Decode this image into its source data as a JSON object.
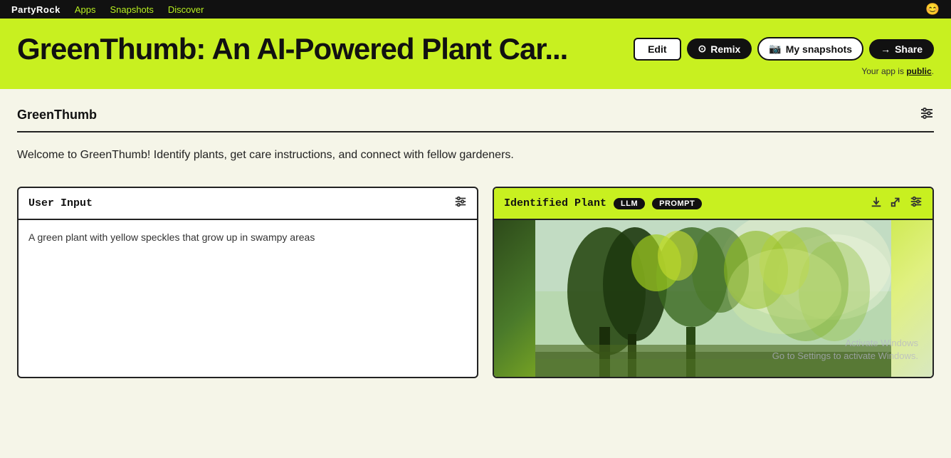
{
  "nav": {
    "brand": "PartyRock",
    "links": [
      {
        "label": "Apps",
        "active": false
      },
      {
        "label": "Snapshots",
        "active": false
      },
      {
        "label": "Discover",
        "active": false
      }
    ],
    "emoji": "😊"
  },
  "hero": {
    "title": "GreenThumb: An AI-Powered Plant Car...",
    "buttons": {
      "edit": "Edit",
      "remix_icon": "⊙",
      "remix": "Remix",
      "snapshots_icon": "📷",
      "snapshots": "My snapshots",
      "share_icon": "→",
      "share": "Share"
    },
    "public_text": "Your app is",
    "public_link": "public"
  },
  "app": {
    "title": "GreenThumb",
    "sliders_icon": "⚙",
    "description": "Welcome to GreenThumb! Identify plants, get care instructions, and connect with fellow gardeners."
  },
  "widgets": {
    "user_input": {
      "title": "User Input",
      "sliders_icon": "⚙",
      "text": "A green plant with yellow speckles that grow up in swampy areas"
    },
    "identified_plant": {
      "title": "Identified Plant",
      "badge_llm": "LLM",
      "badge_prompt": "PROMPT",
      "download_icon": "⬇",
      "export_icon": "↗",
      "sliders_icon": "⚙",
      "watermark_line1": "Activate Windows",
      "watermark_line2": "Go to Settings to activate Windows."
    }
  }
}
